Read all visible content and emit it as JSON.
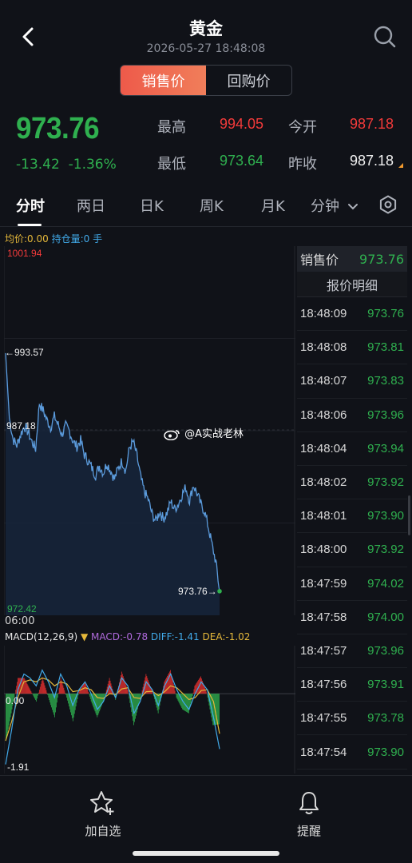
{
  "header": {
    "title": "黄金",
    "datetime": "2026-05-27 18:48:08"
  },
  "segment": {
    "sell_label": "销售价",
    "buy_label": "回购价",
    "active": "sell"
  },
  "quote": {
    "price": "973.76",
    "change": "-13.42",
    "change_pct": "-1.36%",
    "high_label": "最高",
    "high": "994.05",
    "open_label": "今开",
    "open": "987.18",
    "low_label": "最低",
    "low": "973.64",
    "prev_close_label": "昨收",
    "prev_close": "987.18"
  },
  "tabs": {
    "items": [
      "分时",
      "两日",
      "日K",
      "周K",
      "月K",
      "分钟"
    ],
    "active": "分时"
  },
  "indicators": {
    "avg_label": "均价:0.00",
    "hold_label": "持仓量:0 手"
  },
  "chart_data": [
    {
      "type": "line",
      "y_labels": {
        "max": "1001.94",
        "min": "972.42",
        "open_ref": "987.18",
        "day_high_marker": "←993.57",
        "last_marker": "973.76→"
      },
      "ylim": [
        972.42,
        1001.94
      ],
      "x_start_label": "06:00",
      "series": [
        {
          "values": [
            993.57,
            988.2,
            986.4,
            985.9,
            986.8,
            987.5,
            987.0,
            986.2,
            985.6,
            989.4,
            988.8,
            988.0,
            987.4,
            988.3,
            987.6,
            986.8,
            987.5,
            987.1,
            986.2,
            985.8,
            986.3,
            985.1,
            984.6,
            984.0,
            983.4,
            984.2,
            983.6,
            984.4,
            983.8,
            983.1,
            984.0,
            984.6,
            983.8,
            985.7,
            986.2,
            985.0,
            983.2,
            982.0,
            981.4,
            980.2,
            979.6,
            980.4,
            979.8,
            980.3,
            981.2,
            980.6,
            981.0,
            981.8,
            982.4,
            981.3,
            982.6,
            981.9,
            981.0,
            980.4,
            979.1,
            977.6,
            976.2,
            973.76
          ]
        }
      ]
    },
    {
      "type": "line",
      "title": "MACD(12,26,9)",
      "macd_label": "MACD:-0.78",
      "diff_label": "DIFF:-1.41",
      "dea_label": "DEA:-1.02",
      "y_labels": {
        "zero": "0.00",
        "min": "-1.91"
      },
      "ylim": [
        -1.91,
        1.1
      ],
      "series": [
        {
          "name": "DIFF",
          "values": [
            -1.8,
            -0.9,
            0.1,
            0.5,
            0.4,
            0.2,
            0.6,
            0.3,
            -0.1,
            0.5,
            0.2,
            -0.3,
            0.1,
            0.3,
            0.0,
            -0.4,
            -0.2,
            0.2,
            -0.1,
            0.4,
            0.2,
            -0.5,
            -0.2,
            0.3,
            0.1,
            -0.3,
            0.2,
            0.5,
            0.1,
            -0.2,
            -0.4,
            0.0,
            0.3,
            0.1,
            -0.6,
            -1.41
          ]
        },
        {
          "name": "DEA",
          "values": [
            -1.2,
            -0.7,
            -0.1,
            0.3,
            0.35,
            0.3,
            0.4,
            0.35,
            0.2,
            0.3,
            0.25,
            0.05,
            0.08,
            0.15,
            0.1,
            -0.1,
            -0.12,
            0.0,
            -0.02,
            0.12,
            0.15,
            -0.1,
            -0.12,
            0.05,
            0.06,
            -0.05,
            0.05,
            0.2,
            0.15,
            0.0,
            -0.15,
            -0.1,
            0.08,
            0.1,
            -0.2,
            -1.02
          ]
        },
        {
          "name": "MACD",
          "values": [
            -1.2,
            -0.4,
            0.4,
            0.4,
            0.1,
            -0.2,
            0.4,
            -0.1,
            -0.6,
            0.4,
            -0.1,
            -0.7,
            0.05,
            0.3,
            -0.2,
            -0.6,
            -0.2,
            0.4,
            -0.16,
            0.56,
            0.1,
            -0.8,
            -0.16,
            0.5,
            0.08,
            -0.5,
            0.3,
            0.6,
            -0.1,
            -0.4,
            -0.5,
            0.2,
            0.44,
            0.0,
            -0.8,
            -0.78
          ]
        }
      ]
    }
  ],
  "watermark": "@A实战老林",
  "quotes_panel": {
    "sell_label": "销售价",
    "sell_price": "973.76",
    "title": "报价明细",
    "rows": [
      {
        "time": "18:48:09",
        "price": "973.76"
      },
      {
        "time": "18:48:08",
        "price": "973.81"
      },
      {
        "time": "18:48:07",
        "price": "973.83"
      },
      {
        "time": "18:48:06",
        "price": "973.96"
      },
      {
        "time": "18:48:04",
        "price": "973.94"
      },
      {
        "time": "18:48:02",
        "price": "973.92"
      },
      {
        "time": "18:48:01",
        "price": "973.90"
      },
      {
        "time": "18:48:00",
        "price": "973.92"
      },
      {
        "time": "18:47:59",
        "price": "974.02"
      },
      {
        "time": "18:47:58",
        "price": "974.00"
      },
      {
        "time": "18:47:57",
        "price": "973.96"
      },
      {
        "time": "18:47:56",
        "price": "973.91"
      },
      {
        "time": "18:47:55",
        "price": "973.78"
      },
      {
        "time": "18:47:54",
        "price": "973.90"
      }
    ]
  },
  "bottom_bar": {
    "favorite_label": "加自选",
    "alert_label": "提醒"
  },
  "colors": {
    "up": "#f23a3a",
    "down": "#2fb04f",
    "line": "#5b9bdc",
    "accent": "#ee5a4a"
  },
  "icons": [
    "back-arrow-icon",
    "search-icon",
    "chevron-down-icon",
    "gear-icon",
    "star-plus-icon",
    "bell-icon"
  ]
}
